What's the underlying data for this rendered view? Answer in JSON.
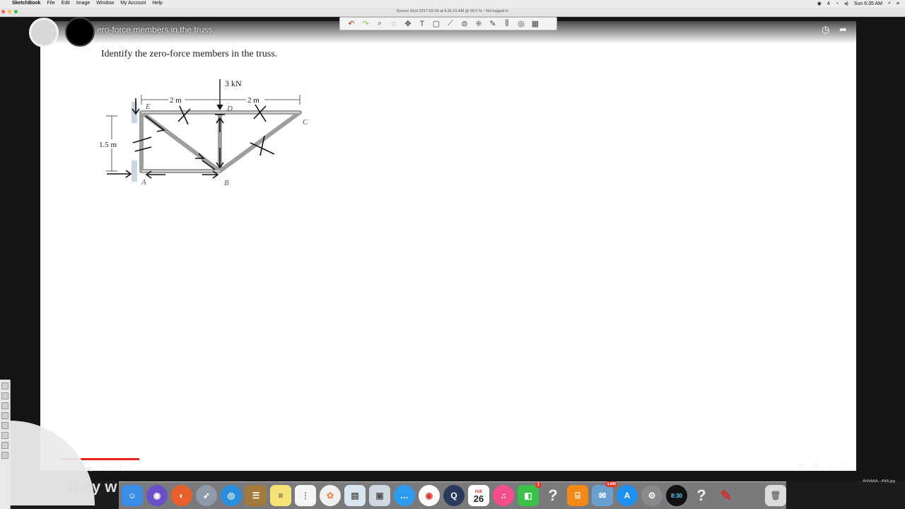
{
  "menubar": {
    "app": "SketchBook",
    "items": [
      "File",
      "Edit",
      "Image",
      "Window",
      "My Account",
      "Help"
    ],
    "clock": "Sun 6:35 AM",
    "battery_label": "4"
  },
  "window": {
    "title": "Screen Shot 2017-02-26 at 6.31.01 AM @ 90.2 % - Not logged in"
  },
  "video": {
    "title": "ero-force members in the truss",
    "heading": "Identify the zero-force members in the truss.",
    "time": "0:12 / 1:54",
    "progress": 0.1,
    "caption": "they w",
    "file_label": "AhNAAA...4NA.jpg"
  },
  "truss": {
    "load": "3 kN",
    "dim_left": "2 m",
    "dim_right": "2 m",
    "height": "1.5 m",
    "nodes": [
      "E",
      "D",
      "C",
      "A",
      "B"
    ]
  },
  "dock": {
    "calendar_day": "26",
    "calendar_month": "FEB",
    "mail_badge": "3,696",
    "facetime_badge": "1",
    "clock_label": "8:30"
  },
  "colors": {
    "progress": "#e62117"
  }
}
